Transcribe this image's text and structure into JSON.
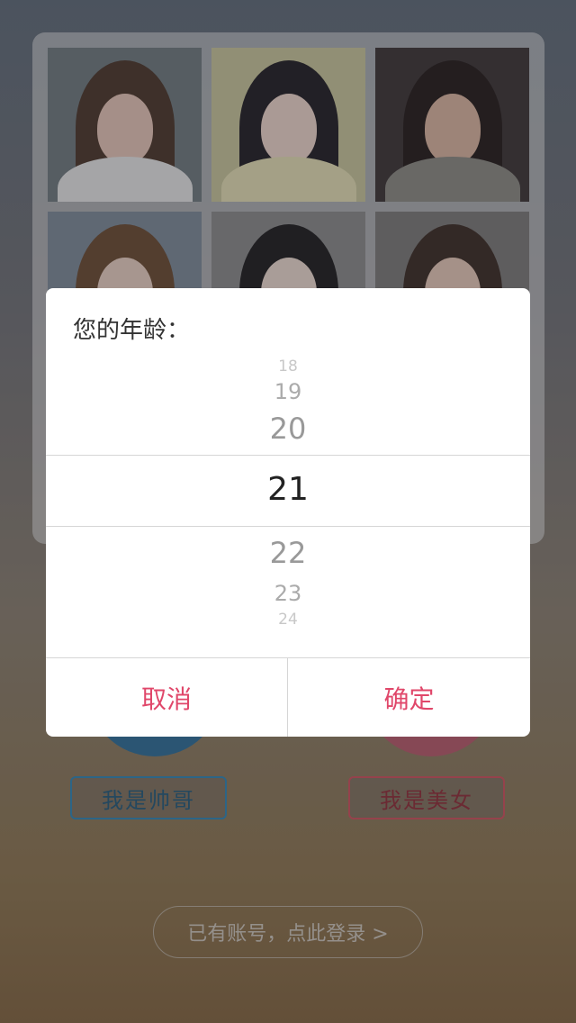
{
  "photos": [
    {
      "bg": "#6f7a7f",
      "hair": "#4a3528",
      "face": "#e9c7b8",
      "torso": "#e9e9e9"
    },
    {
      "bg": "#c9c79b",
      "hair": "#1f1c22",
      "face": "#f0d8cc",
      "torso": "#e6e1b5"
    },
    {
      "bg": "#3b3334",
      "hair": "#221a18",
      "face": "#dcb6a0",
      "torso": "#8c8a83"
    },
    {
      "bg": "#7d8a99",
      "hair": "#6a4a30",
      "face": "#ecd1c4",
      "torso": "#c7b3a5"
    },
    {
      "bg": "#8a8a8a",
      "hair": "#1c1b1d",
      "face": "#efdcd2",
      "torso": "#2a2a2a"
    },
    {
      "bg": "#7c7a78",
      "hair": "#3a2a22",
      "face": "#e8c9b9",
      "torso": "#6d5c50"
    }
  ],
  "dialog": {
    "title": "您的年龄：",
    "picker": {
      "above": [
        "18",
        "19",
        "20"
      ],
      "selected": "21",
      "below": [
        "22",
        "23",
        "24"
      ]
    },
    "cancel_label": "取消",
    "ok_label": "确定"
  },
  "gender": {
    "male_label": "我是帅哥",
    "female_label": "我是美女"
  },
  "login_label": "已有账号，点此登录 >",
  "colors": {
    "accent": "#e0476a",
    "male": "#2f86b7",
    "female": "#d0505c"
  }
}
